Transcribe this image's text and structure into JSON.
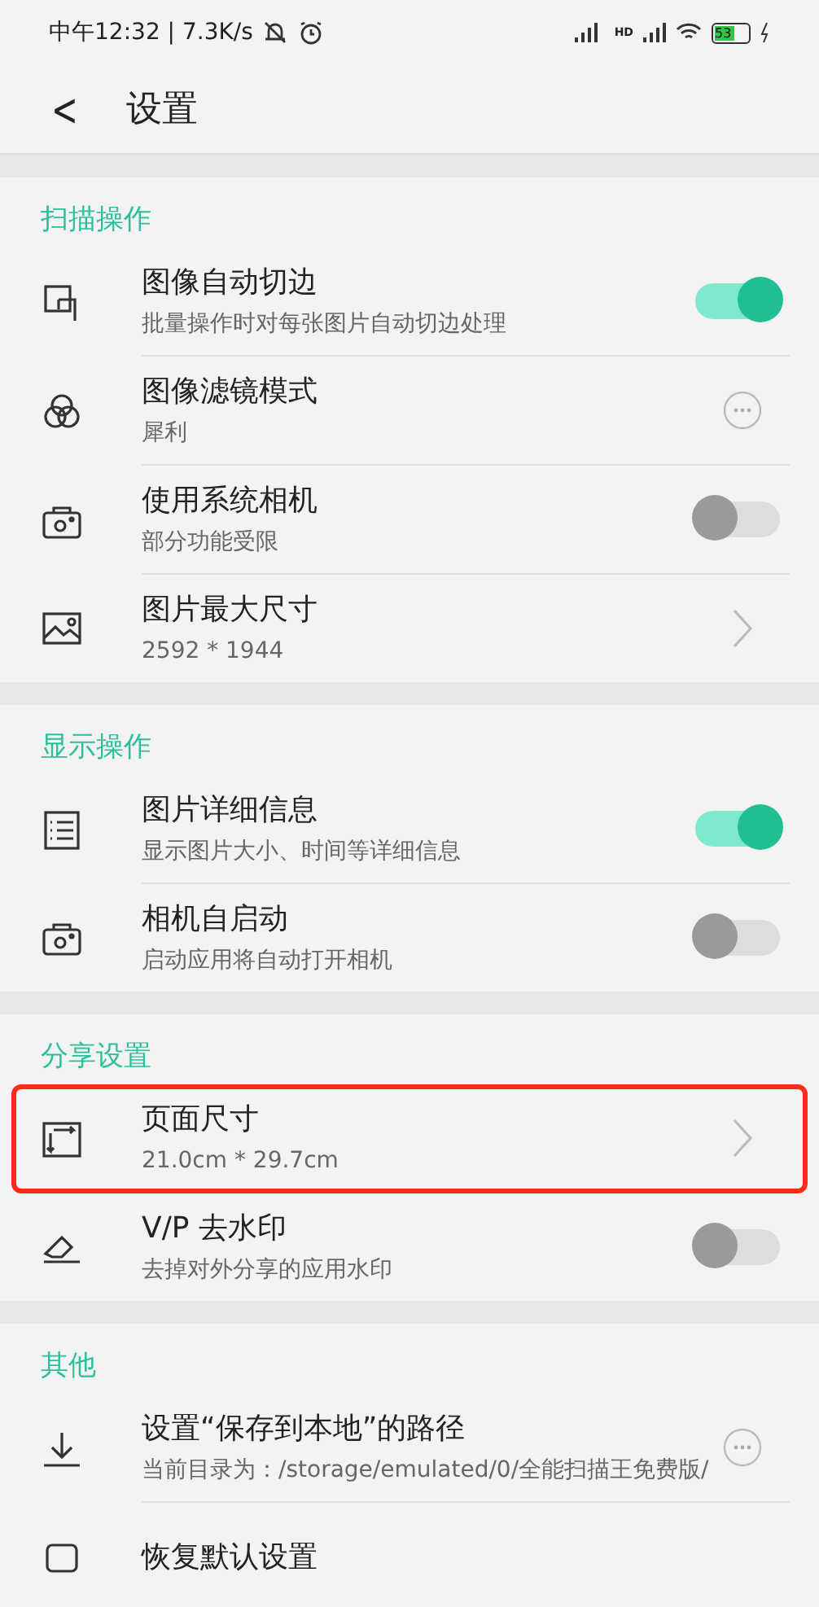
{
  "status_bar": {
    "time": "中午12:32 | 7.3K/s",
    "network_label": "HD",
    "battery": "53"
  },
  "header": {
    "back": "<",
    "title": "设置"
  },
  "sections": [
    {
      "title": "扫描操作",
      "items": [
        {
          "title": "图像自动切边",
          "subtitle": "批量操作时对每张图片自动切边处理",
          "kind": "toggle",
          "on": true,
          "highlighted": false
        },
        {
          "title": "图像滤镜模式",
          "subtitle": "犀利",
          "kind": "more",
          "highlighted": false
        },
        {
          "title": "使用系统相机",
          "subtitle": "部分功能受限",
          "kind": "toggle",
          "on": false,
          "highlighted": false
        },
        {
          "title": "图片最大尺寸",
          "subtitle": "2592 * 1944",
          "kind": "chevron",
          "highlighted": false
        }
      ]
    },
    {
      "title": "显示操作",
      "items": [
        {
          "title": "图片详细信息",
          "subtitle": "显示图片大小、时间等详细信息",
          "kind": "toggle",
          "on": true,
          "highlighted": false
        },
        {
          "title": "相机自启动",
          "subtitle": "启动应用将自动打开相机",
          "kind": "toggle",
          "on": false,
          "highlighted": false
        }
      ]
    },
    {
      "title": "分享设置",
      "items": [
        {
          "title": "页面尺寸",
          "subtitle": "21.0cm * 29.7cm",
          "kind": "chevron",
          "highlighted": true
        },
        {
          "title": "V/P 去水印",
          "subtitle": "去掉对外分享的应用水印",
          "kind": "toggle",
          "on": false,
          "highlighted": false
        }
      ]
    },
    {
      "title": "其他",
      "items": [
        {
          "title": "设置“保存到本地”的路径",
          "subtitle": "当前目录为：/storage/emulated/0/全能扫描王免费版/",
          "kind": "more",
          "highlighted": false
        },
        {
          "title": "恢复默认设置",
          "kind": "none",
          "highlighted": false
        }
      ]
    }
  ]
}
